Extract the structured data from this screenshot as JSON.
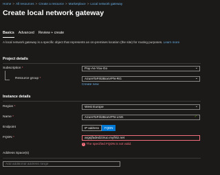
{
  "breadcrumb": [
    "Home",
    "All resources",
    "Create a resource",
    "Marketplace",
    "Local network gateway"
  ],
  "page_title": "Create local network gateway",
  "more_menu": "...",
  "tabs": [
    "Basics",
    "Advanced",
    "Review + create"
  ],
  "description": "A local network gateway is a specific object that represents an on-premises location (the site) for routing purposes.",
  "learn_more": "Learn more",
  "project_details": {
    "title": "Project details",
    "subscription_label": "Subscription",
    "subscription_value": "Pay-As-You-Go",
    "resource_group_label": "Resource group",
    "resource_group_value": "AzureToFritzBoxVPN-RG",
    "create_new": "Create new"
  },
  "instance_details": {
    "title": "Instance details",
    "region_label": "Region",
    "region_value": "West Europe",
    "name_label": "Name",
    "name_value": "AzureToFritzBoxVPN-LNG",
    "endpoint_label": "Endpoint",
    "endpoint_options": [
      "IP address",
      "FQDN"
    ],
    "endpoint_selected": "FQDN",
    "fqdn_label": "FQDN",
    "fqdn_value": "argsjfaded23ruo.myfritz.net",
    "fqdn_error": "The specified FQDN is not valid.",
    "address_space_label": "Address Space(s)",
    "address_space_placeholder": "Add additional address range"
  },
  "colors": {
    "accent": "#0078d4",
    "error": "#f1707b",
    "link": "#69afe5",
    "background": "#1b1a19"
  },
  "required_marker": "*"
}
